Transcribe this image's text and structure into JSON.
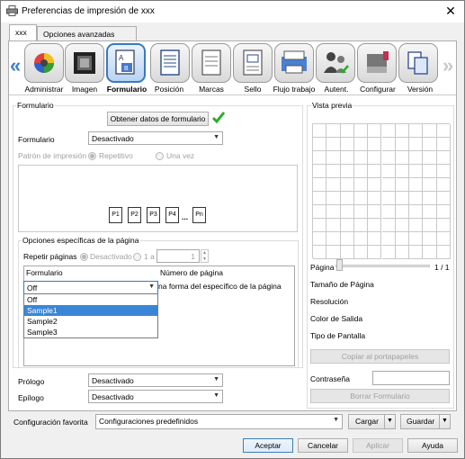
{
  "window": {
    "title": "Preferencias de impresión de xxx",
    "close_glyph": "✕"
  },
  "tabs": [
    {
      "label": "xxx"
    },
    {
      "label": "Opciones avanzadas"
    }
  ],
  "icon_bar": {
    "left_arrow": "«",
    "right_arrow": "»",
    "items": [
      {
        "label": "Administrar",
        "icon": "palette-icon"
      },
      {
        "label": "Imagen",
        "icon": "image-icon"
      },
      {
        "label": "Formulario",
        "icon": "form-icon",
        "selected": true
      },
      {
        "label": "Posición",
        "icon": "position-icon"
      },
      {
        "label": "Marcas",
        "icon": "marks-icon"
      },
      {
        "label": "Sello",
        "icon": "stamp-icon"
      },
      {
        "label": "Flujo trabajo",
        "icon": "workflow-icon"
      },
      {
        "label": "Autent.",
        "icon": "auth-icon"
      },
      {
        "label": "Configurar",
        "icon": "printer-icon"
      },
      {
        "label": "Versión",
        "icon": "version-icon"
      }
    ]
  },
  "form": {
    "section_title": "Formulario",
    "get_data_button": "Obtener datos de formulario",
    "form_label": "Formulario",
    "form_value": "Desactivado",
    "pattern_label": "Patrón de impresión",
    "pattern_repeat": "Repetitivo",
    "pattern_once": "Una vez",
    "pages": [
      "P1",
      "P2",
      "P3",
      "P4",
      "...",
      "Pn"
    ],
    "page_specific_title": "Opciones específicas de la página",
    "repeat_pages_label": "Repetir páginas",
    "repeat_off": "Desactivado",
    "repeat_range": "1 a",
    "repeat_to_value": "1",
    "table_headers": [
      "Formulario",
      "Número de página"
    ],
    "row_partial_text": "na forma del específico de la página",
    "dropdown_value": "Off",
    "dropdown_options": [
      "Off",
      "Sample1",
      "Sample2",
      "Sample3"
    ],
    "dropdown_highlight_index": 1,
    "prologue_label": "Prólogo",
    "prologue_value": "Desactivado",
    "epilogue_label": "Epílogo",
    "epilogue_value": "Desactivado"
  },
  "preview": {
    "title": "Vista previa",
    "page_label": "Página",
    "page_count": "1 / 1",
    "info_rows": [
      "Tamaño de Página",
      "Resolución",
      "Color de Salida",
      "Tipo de Pantalla"
    ],
    "copy_button": "Copiar al portapapeles",
    "password_label": "Contraseña",
    "password_value": "",
    "delete_form_button": "Borrar Formulario"
  },
  "favorites": {
    "label": "Configuración favorita",
    "value": "Configuraciones predefinidos",
    "load_button": "Cargar",
    "save_button": "Guardar"
  },
  "footer": {
    "ok": "Aceptar",
    "cancel": "Cancelar",
    "apply": "Aplicar",
    "help": "Ayuda"
  },
  "colors": {
    "accent": "#3a78c2",
    "check": "#2eaa2e",
    "highlight": "#3a86d6"
  }
}
